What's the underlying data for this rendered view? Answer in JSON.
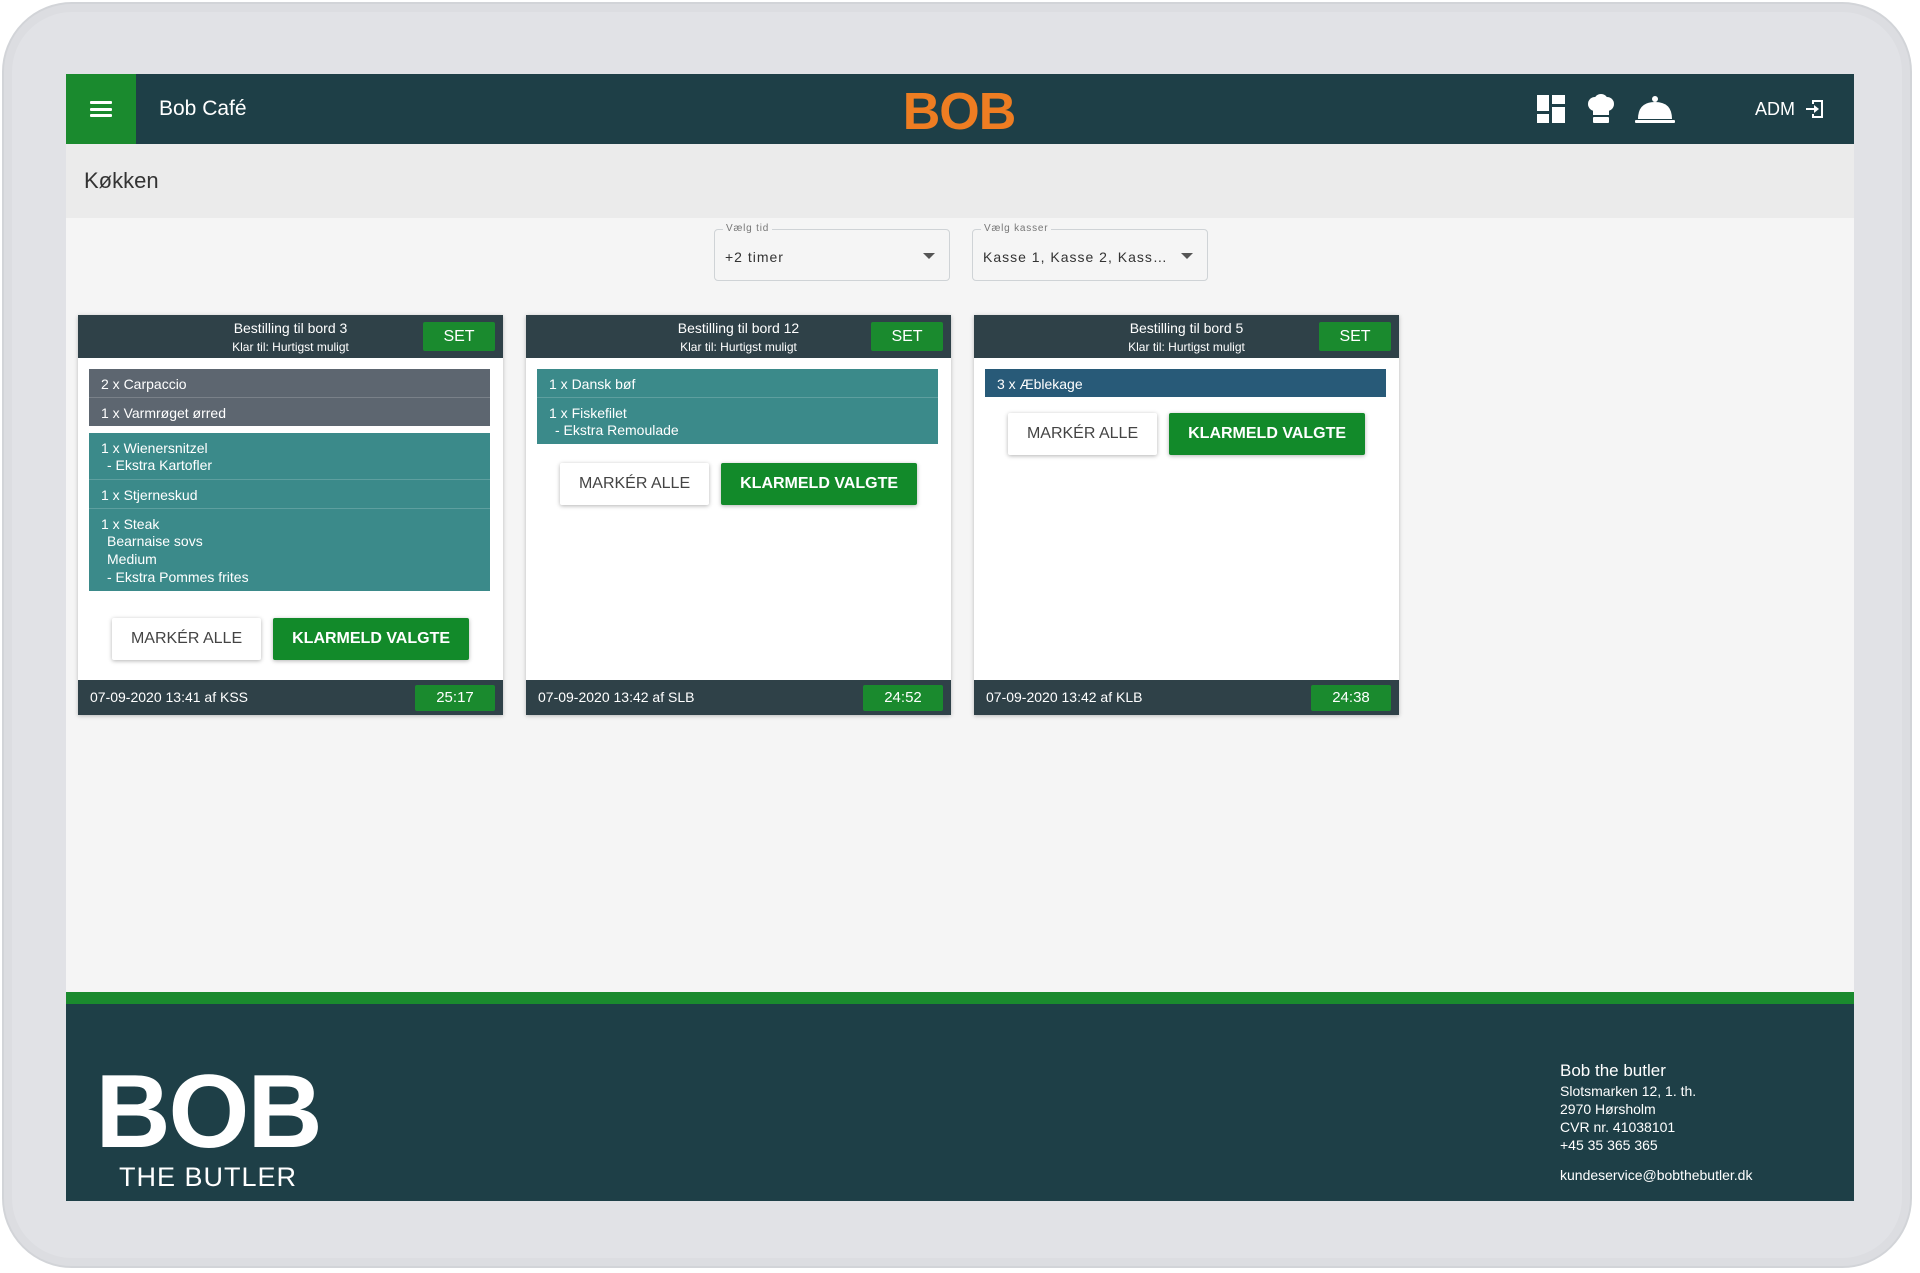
{
  "header": {
    "app_title": "Bob Café",
    "brand": "BOB",
    "user": "ADM",
    "icons": [
      "menu-icon",
      "dashboard-icon",
      "chef-hat-icon",
      "cloche-icon",
      "logout-icon"
    ],
    "colors": {
      "bar": "#1e3f47",
      "accent": "#1a8a2e",
      "brand": "#ee7d22"
    }
  },
  "page": {
    "title": "Køkken"
  },
  "filters": {
    "time": {
      "label": "Vælg tid",
      "value": "+2 timer"
    },
    "registers": {
      "label": "Vælg kasser",
      "value": "Kasse 1, Kasse 2, Kass…"
    }
  },
  "common": {
    "mark_all": "MARKÉR ALLE",
    "report_ready": "KLARMELD VALGTE",
    "set": "SET"
  },
  "orders": [
    {
      "title": "Bestilling til bord 3",
      "ready": "Klar til: Hurtigst muligt",
      "groups": [
        {
          "color": "gray",
          "items": [
            {
              "name": "2 x Carpaccio",
              "mods": []
            },
            {
              "name": "1 x Varmrøget ørred",
              "mods": []
            }
          ]
        },
        {
          "color": "teal",
          "items": [
            {
              "name": "1 x Wienersnitzel",
              "mods": [
                "- Ekstra Kartofler"
              ]
            },
            {
              "name": "1 x Stjerneskud",
              "mods": []
            },
            {
              "name": "1 x Steak",
              "mods": [
                "Bearnaise sovs",
                "Medium",
                "- Ekstra Pommes frites"
              ]
            }
          ]
        }
      ],
      "footer": "07-09-2020 13:41 af KSS",
      "timer": "25:17"
    },
    {
      "title": "Bestilling til bord 12",
      "ready": "Klar til: Hurtigst muligt",
      "groups": [
        {
          "color": "teal",
          "items": [
            {
              "name": "1 x Dansk bøf",
              "mods": []
            },
            {
              "name": "1 x Fiskefilet",
              "mods": [
                "- Ekstra Remoulade"
              ]
            }
          ]
        }
      ],
      "footer": "07-09-2020 13:42 af SLB",
      "timer": "24:52"
    },
    {
      "title": "Bestilling til bord 5",
      "ready": "Klar til: Hurtigst muligt",
      "groups": [
        {
          "color": "blue",
          "items": [
            {
              "name": "3 x Æblekage",
              "mods": []
            }
          ]
        }
      ],
      "footer": "07-09-2020 13:42 af KLB",
      "timer": "24:38"
    }
  ],
  "footer": {
    "logo_main": "BOB",
    "logo_sub": "THE BUTLER",
    "company_name": "Bob the butler",
    "address1": "Slotsmarken 12, 1. th.",
    "address2": "2970 Hørsholm",
    "cvr": "CVR nr. 41038101",
    "phone": "+45 35 365 365",
    "email": "kundeservice@bobthebutler.dk"
  }
}
